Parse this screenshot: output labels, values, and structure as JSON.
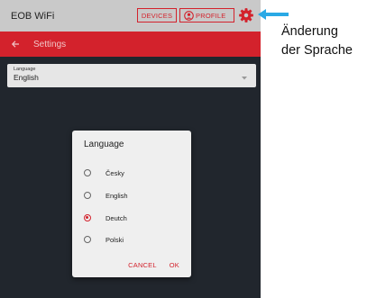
{
  "colors": {
    "accent": "#d3222c",
    "topbar": "#c9c9c9",
    "background": "#21262d",
    "callout": "#2aa9e5"
  },
  "app": {
    "title": "EOB WiFi",
    "devices_label": "DEVICES",
    "profile_label": "PROFILE",
    "settings_icon": "gear-icon"
  },
  "header": {
    "back_icon": "back-arrow-icon",
    "title": "Settings"
  },
  "language_field": {
    "label": "Language",
    "value": "English"
  },
  "dialog": {
    "title": "Language",
    "options": [
      {
        "label": "Česky",
        "selected": false
      },
      {
        "label": "English",
        "selected": false
      },
      {
        "label": "Deutch",
        "selected": true
      },
      {
        "label": "Polski",
        "selected": false
      }
    ],
    "cancel_label": "CANCEL",
    "ok_label": "OK"
  },
  "annotation": {
    "line1": "Änderung",
    "line2": "der Sprache"
  }
}
